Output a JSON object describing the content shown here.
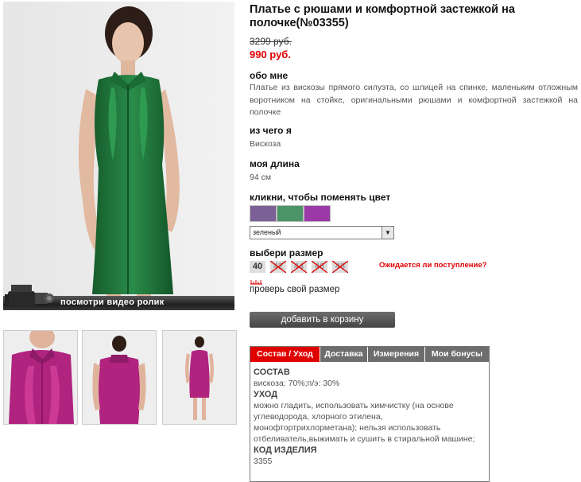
{
  "product": {
    "title": "Платье с рюшами и комфортной застежкой на полочке(№03355)",
    "old_price": "3299 руб.",
    "new_price": "990 руб."
  },
  "about": {
    "heading": "обо мне",
    "text": "Платье из вискозы прямого силуэта, со шлицей на спинке, маленьким отложным воротником на стойке, оригинальными рюшами и комфортной застежкой на полочке"
  },
  "material": {
    "heading": "из чего я",
    "text": "Вискоза"
  },
  "length": {
    "heading": "моя длина",
    "text": "94 см"
  },
  "color": {
    "heading": "кликни, чтобы поменять цвет",
    "swatches": [
      "#7b5f97",
      "#4a9468",
      "#9b39a8"
    ],
    "selected": "зеленый"
  },
  "size": {
    "heading": "выбери размер",
    "options": [
      "40",
      "42",
      "44",
      "46",
      "48"
    ],
    "waiting_link": "Ожидается ли поступление?",
    "check_link": "проверь свой размер"
  },
  "video_label": "посмотри видео ролик",
  "cart_button": "добавить в корзину",
  "tabs": {
    "labels": [
      "Состав / Уход",
      "Доставка",
      "Измерения",
      "Мои бонусы"
    ],
    "content": {
      "composition_h": "СОСТАВ",
      "composition": "вискоза: 70%;п/э: 30%",
      "care_h": "УХОД",
      "care": "можно гладить, использовать химчистку (на основе углеводорода, хлорного этилена, монофтортрихлорметана); нельзя использовать отбеливатель,выжимать и сушить в стиральной машине;",
      "code_h": "КОД ИЗДЕЛИЯ",
      "code": "3355"
    }
  },
  "colors": {
    "accent": "#e00000",
    "dress_main": "#1f7a3d",
    "dress_alt": "#b0237f"
  }
}
